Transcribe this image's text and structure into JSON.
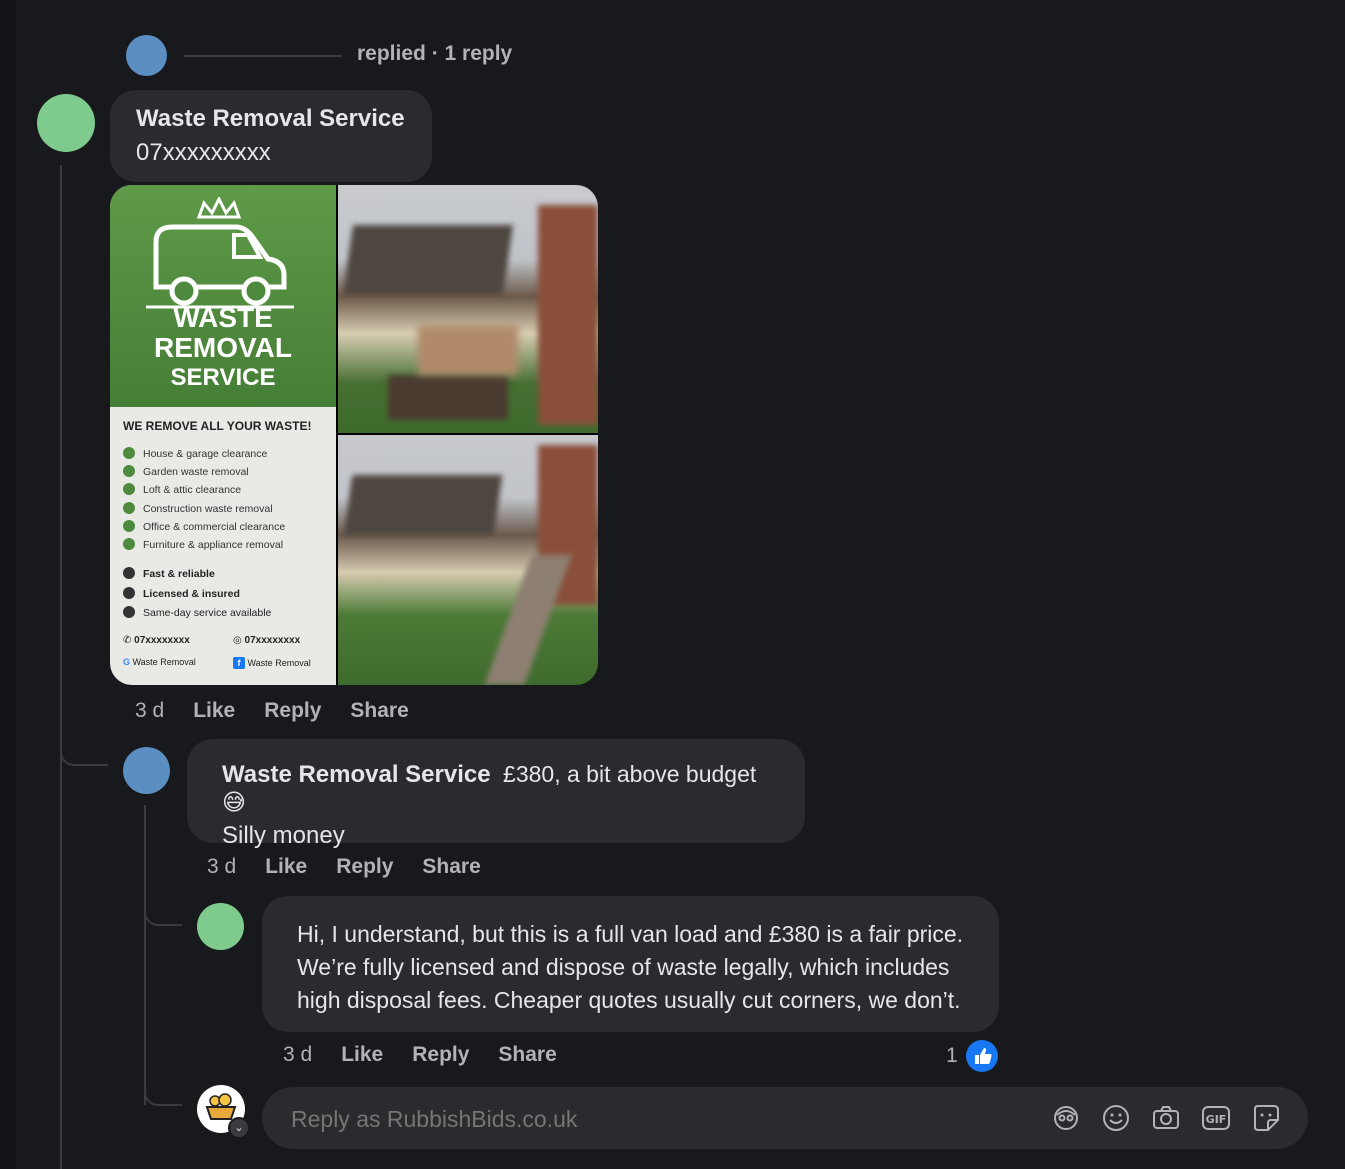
{
  "thread": {
    "replied_text": "replied · 1 reply"
  },
  "comment1": {
    "author": "Waste Removal Service",
    "text": "07xxxxxxxxx",
    "time": "3 d",
    "like": "Like",
    "reply": "Reply",
    "share": "Share"
  },
  "flyer": {
    "title_line1": "WASTE",
    "title_line2": "REMOVAL",
    "title_line3": "SERVICE",
    "headline": "WE REMOVE ALL YOUR WASTE!",
    "services": [
      "House & garage clearance",
      "Garden waste removal",
      "Loft & attic clearance",
      "Construction waste removal",
      "Office & commercial clearance",
      "Furniture & appliance removal"
    ],
    "features": [
      "Fast & reliable",
      "Licensed & insured",
      "Same-day service available"
    ],
    "phone1": "07xxxxxxxx",
    "phone2": "07xxxxxxxx",
    "google_label": "Waste Removal",
    "facebook_label": "Waste Removal"
  },
  "comment2": {
    "author": "Waste Removal Service",
    "text_inline": "£380, a bit above budget 😅",
    "text_line2": "Silly money",
    "time": "3 d",
    "like": "Like",
    "reply": "Reply",
    "share": "Share"
  },
  "comment3": {
    "line1": "Hi, I understand, but this is a full van load and £380 is a fair price.",
    "line2": "We’re fully licensed and dispose of waste legally, which includes",
    "line3": "high disposal fees. Cheaper quotes usually cut corners, we don’t.",
    "time": "3 d",
    "like": "Like",
    "reply": "Reply",
    "share": "Share",
    "like_count": "1"
  },
  "composer": {
    "placeholder": "Reply as RubbishBids.co.uk",
    "icons": [
      "avatar-sticker-icon",
      "emoji-icon",
      "camera-icon",
      "gif-icon",
      "sticker-icon"
    ]
  },
  "colors": {
    "background": "#18191d",
    "bubble": "#2a2b2f",
    "avatar_blue": "#5b8fc2",
    "avatar_green": "#7fcb8e",
    "like_blue": "#1877f2",
    "flyer_green": "#4e8a3e"
  }
}
